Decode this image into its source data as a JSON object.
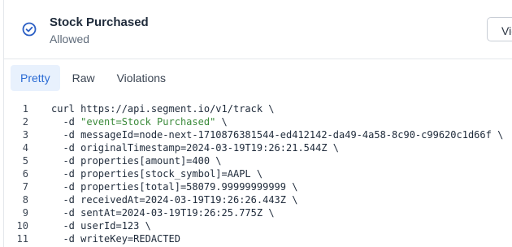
{
  "header": {
    "title": "Stock Purchased",
    "status": "Allowed",
    "view_button_label": "View"
  },
  "tabs": [
    {
      "label": "Pretty",
      "active": true
    },
    {
      "label": "Raw",
      "active": false
    },
    {
      "label": "Violations",
      "active": false
    }
  ],
  "code_lines": [
    {
      "num": "1",
      "indent": "",
      "pre": "curl https://api.segment.io/v1/track \\",
      "str": "",
      "post": ""
    },
    {
      "num": "2",
      "indent": "  ",
      "pre": "-d ",
      "str": "\"event=Stock Purchased\"",
      "post": " \\"
    },
    {
      "num": "3",
      "indent": "  ",
      "pre": "-d messageId=node-next-1710876381544-ed412142-da49-4a58-8c90-c99620c1d66f \\",
      "str": "",
      "post": ""
    },
    {
      "num": "4",
      "indent": "  ",
      "pre": "-d originalTimestamp=2024-03-19T19:26:21.544Z \\",
      "str": "",
      "post": ""
    },
    {
      "num": "5",
      "indent": "  ",
      "pre": "-d properties[amount]=400 \\",
      "str": "",
      "post": ""
    },
    {
      "num": "6",
      "indent": "  ",
      "pre": "-d properties[stock_symbol]=AAPL \\",
      "str": "",
      "post": ""
    },
    {
      "num": "7",
      "indent": "  ",
      "pre": "-d properties[total]=58079.99999999999 \\",
      "str": "",
      "post": ""
    },
    {
      "num": "8",
      "indent": "  ",
      "pre": "-d receivedAt=2024-03-19T19:26:26.443Z \\",
      "str": "",
      "post": ""
    },
    {
      "num": "9",
      "indent": "  ",
      "pre": "-d sentAt=2024-03-19T19:26:25.775Z \\",
      "str": "",
      "post": ""
    },
    {
      "num": "10",
      "indent": "  ",
      "pre": "-d userId=123 \\",
      "str": "",
      "post": ""
    },
    {
      "num": "11",
      "indent": "  ",
      "pre": "-d writeKey=REDACTED",
      "str": "",
      "post": ""
    }
  ],
  "colors": {
    "accent": "#2b6cd4",
    "active_tab_bg": "#e8f1fd",
    "string": "#3a8a3a"
  },
  "icons": {
    "status": "check-circle-icon"
  }
}
